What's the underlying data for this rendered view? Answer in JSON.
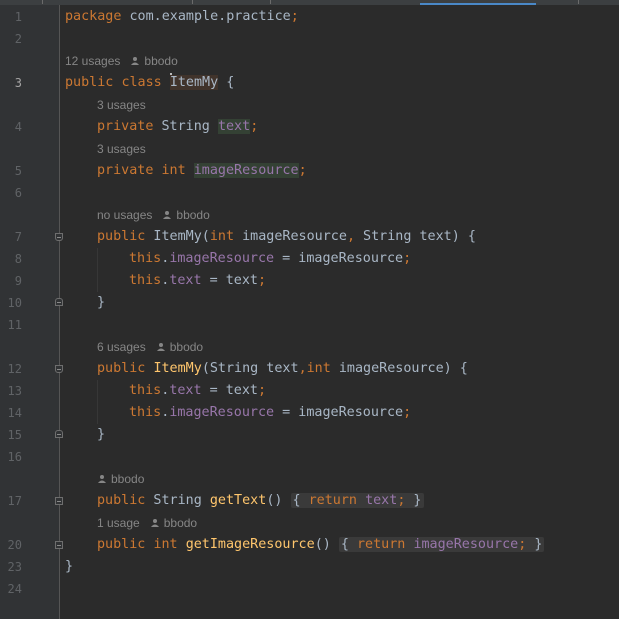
{
  "lines": [
    {
      "num": "1",
      "text_parts": [
        "package",
        " com.example.practice",
        ";"
      ]
    },
    {
      "num": "2"
    },
    {
      "num": "3",
      "text_parts": [
        "public",
        " ",
        "class",
        " ",
        "ItemMy",
        " {"
      ]
    },
    {
      "num": "4",
      "text_parts": [
        "private",
        " String ",
        "text",
        ";"
      ]
    },
    {
      "num": "5",
      "text_parts": [
        "private",
        " ",
        "int",
        " ",
        "imageResource",
        ";"
      ]
    },
    {
      "num": "6"
    },
    {
      "num": "7",
      "text_parts": [
        "public",
        " ItemMy(",
        "int",
        " imageResource",
        ",",
        " String text) {"
      ]
    },
    {
      "num": "8",
      "text_parts": [
        "this",
        ".",
        "imageResource",
        " = imageResource",
        ";"
      ]
    },
    {
      "num": "9",
      "text_parts": [
        "this",
        ".",
        "text",
        " = text",
        ";"
      ]
    },
    {
      "num": "10",
      "text_parts": [
        "}"
      ]
    },
    {
      "num": "11"
    },
    {
      "num": "12",
      "text_parts": [
        "public",
        " ",
        "ItemMy",
        "(String text",
        ",",
        "int",
        " imageResource) {"
      ]
    },
    {
      "num": "13",
      "text_parts": [
        "this",
        ".",
        "text",
        " = text",
        ";"
      ]
    },
    {
      "num": "14",
      "text_parts": [
        "this",
        ".",
        "imageResource",
        " = imageResource",
        ";"
      ]
    },
    {
      "num": "15",
      "text_parts": [
        "}"
      ]
    },
    {
      "num": "16"
    },
    {
      "num": "17",
      "text_parts": [
        "public",
        " String ",
        "getText",
        "() ",
        "{ ",
        "return",
        " ",
        "text",
        ";",
        " }"
      ]
    },
    {
      "num": "20",
      "text_parts": [
        "public",
        " ",
        "int",
        " ",
        "getImageResource",
        "() ",
        "{ ",
        "return",
        " ",
        "imageResource",
        ";",
        " }"
      ]
    },
    {
      "num": "23",
      "text_parts": [
        "}"
      ]
    },
    {
      "num": "24"
    }
  ],
  "hints": {
    "class_usages": "12 usages",
    "class_author": "bbodo",
    "text_usages": "3 usages",
    "image_usages": "3 usages",
    "ctor1_usages": "no usages",
    "ctor1_author": "bbodo",
    "ctor2_usages": "6 usages",
    "ctor2_author": "bbodo",
    "gettext_author": "bbodo",
    "getimage_usages": "1 usage",
    "getimage_author": "bbodo"
  },
  "colors": {
    "background": "#2b2b2b",
    "keyword": "#cc7832",
    "field": "#9876aa",
    "method": "#ffc66d",
    "plain": "#a9b7c6",
    "hint": "#868686"
  },
  "icons": {
    "author": "person-icon",
    "fold": "fold-marker-icon"
  }
}
